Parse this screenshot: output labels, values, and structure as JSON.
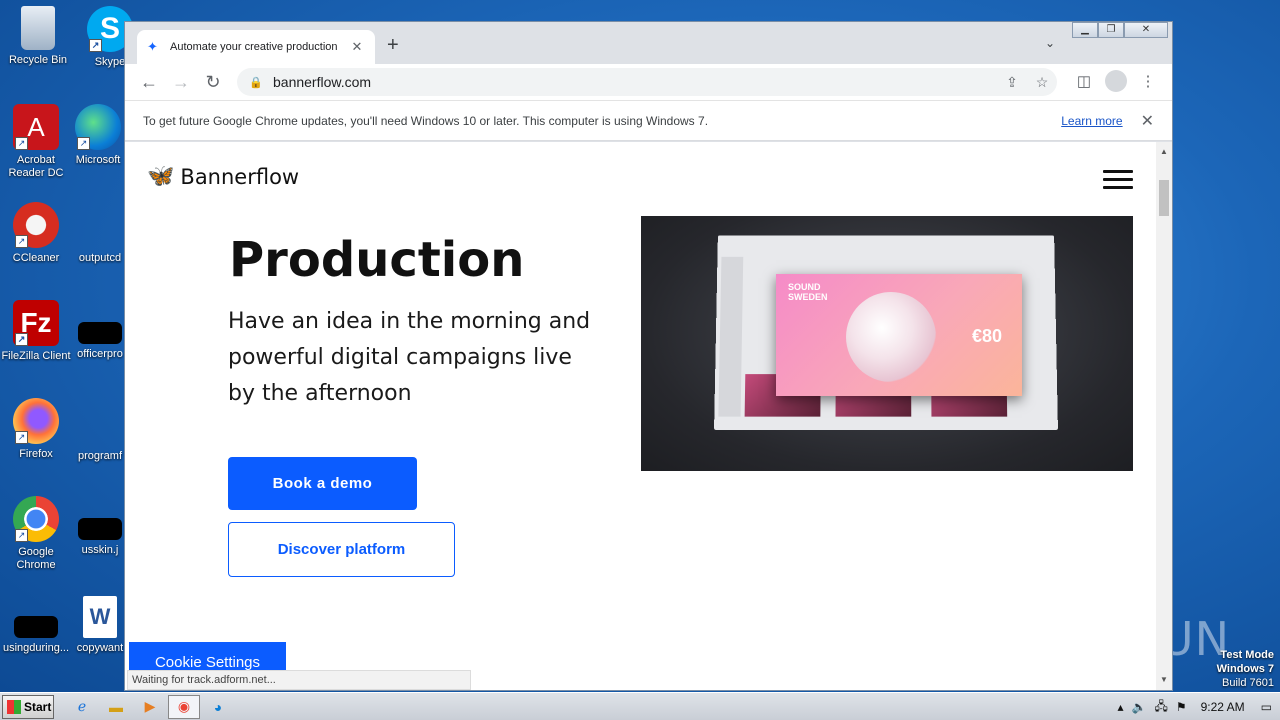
{
  "desktop": {
    "icons": [
      {
        "label": "Recycle Bin",
        "icon": "recycle-bin-icon"
      },
      {
        "label": "Skype",
        "icon": "skype-icon"
      },
      {
        "label": "Acrobat Reader DC",
        "icon": "acrobat-icon"
      },
      {
        "label": "Microsoft",
        "icon": "edge-icon"
      },
      {
        "label": "CCleaner",
        "icon": "ccleaner-icon"
      },
      {
        "label": "outputcd",
        "icon": "file-icon"
      },
      {
        "label": "FileZilla Client",
        "icon": "filezilla-icon"
      },
      {
        "label": "officerpro",
        "icon": "file-icon"
      },
      {
        "label": "Firefox",
        "icon": "firefox-icon"
      },
      {
        "label": "programf",
        "icon": "file-icon"
      },
      {
        "label": "Google Chrome",
        "icon": "chrome-icon"
      },
      {
        "label": "usskin.j",
        "icon": "file-icon"
      },
      {
        "label": "usingduring...",
        "icon": "file-icon"
      },
      {
        "label": "copywant",
        "icon": "word-icon"
      }
    ],
    "watermark": "ANY RUN",
    "test_mode": {
      "line1": "Test Mode",
      "line2": "Windows 7",
      "line3": "Build 7601"
    }
  },
  "browser": {
    "tab_title": "Automate your creative production",
    "url": "bannerflow.com",
    "infobar": {
      "message": "To get future Google Chrome updates, you'll need Windows 10 or later. This computer is using Windows 7.",
      "link": "Learn more"
    },
    "status": "Waiting for track.adform.net..."
  },
  "page": {
    "brand": "Bannerflow",
    "heading": "Production",
    "subheading": "Have an idea in the morning and powerful digital campaigns live by the afternoon",
    "primary_cta": "Book a demo",
    "secondary_cta": "Discover platform",
    "cookie_button": "Cookie Settings",
    "ad": {
      "brand_line1": "SOUND",
      "brand_line2": "SWEDEN",
      "price": "€80"
    }
  },
  "taskbar": {
    "start_label": "Start",
    "clock": "9:22 AM"
  }
}
